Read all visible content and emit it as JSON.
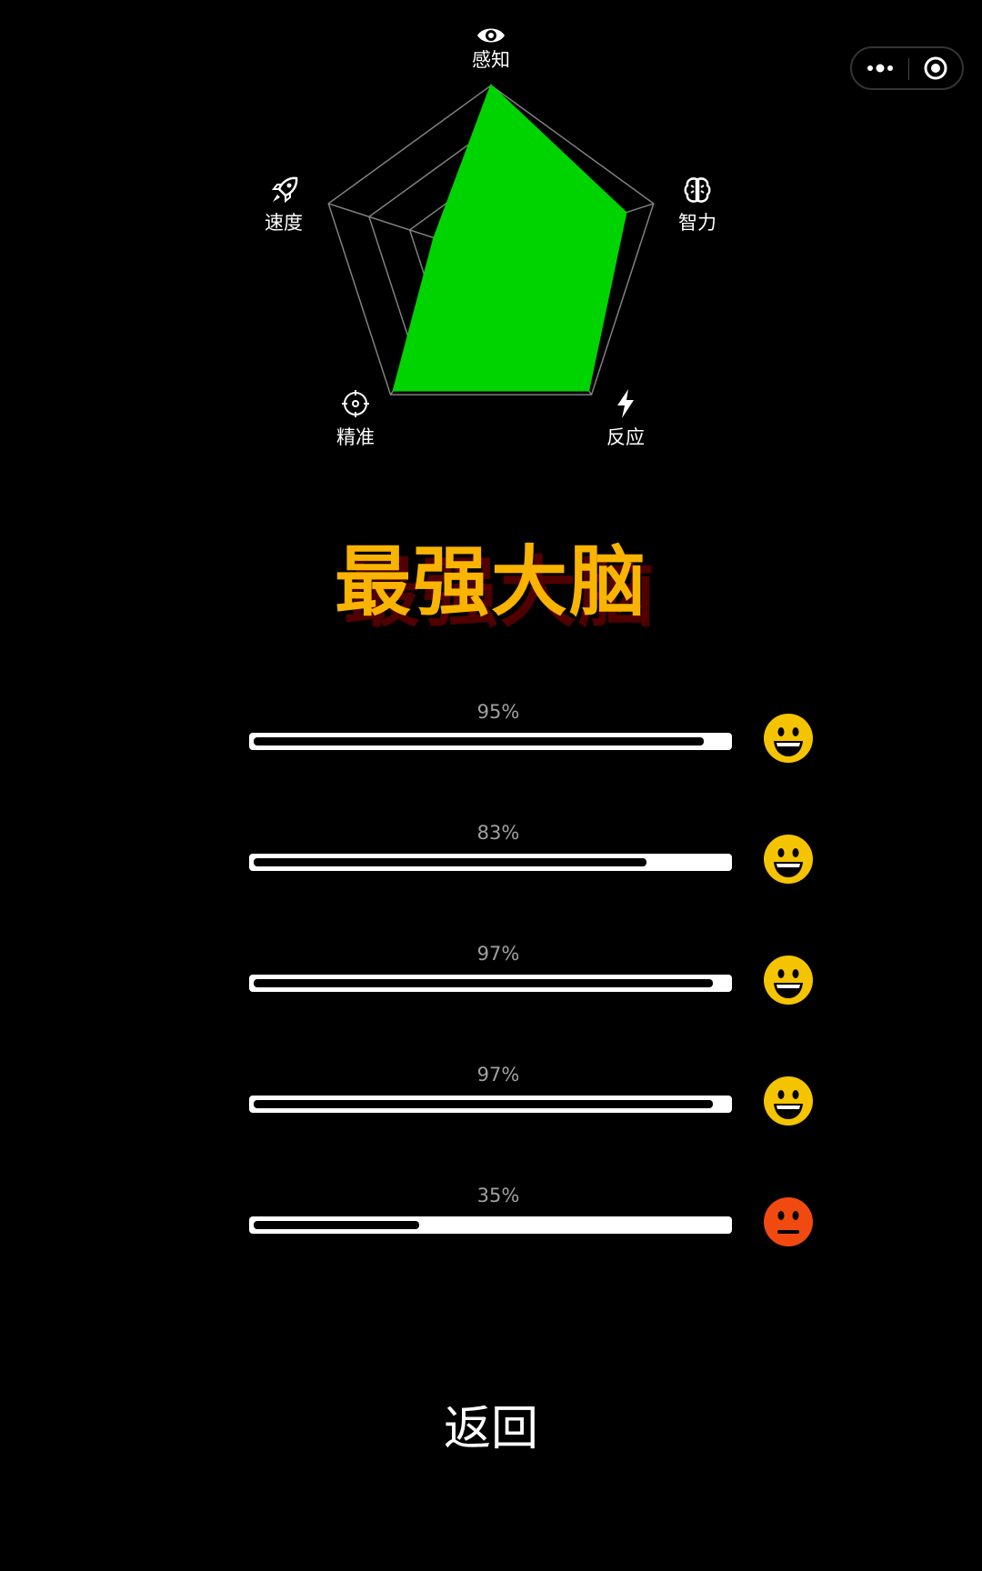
{
  "capsule": {
    "more_icon": "more-dots-icon",
    "close_icon": "target-circle-icon"
  },
  "radar": {
    "axes": [
      {
        "label": "感知",
        "icon": "eye-icon",
        "value": 1.0
      },
      {
        "label": "智力",
        "icon": "brain-icon",
        "value": 0.83
      },
      {
        "label": "反应",
        "icon": "lightning-icon",
        "value": 0.97
      },
      {
        "label": "精准",
        "icon": "crosshair-icon",
        "value": 0.97
      },
      {
        "label": "速度",
        "icon": "rocket-icon",
        "value": 0.35
      }
    ],
    "levels": 4,
    "fill_color": "#00d400",
    "grid_color": "#808080"
  },
  "title": "最强大脑",
  "colors": {
    "title": "#f8b400",
    "happy_face": "#f5c400",
    "neutral_face": "#f04a10"
  },
  "scores": [
    {
      "label": "95%",
      "value": 0.95,
      "mood": "happy"
    },
    {
      "label": "83%",
      "value": 0.83,
      "mood": "happy"
    },
    {
      "label": "97%",
      "value": 0.97,
      "mood": "happy"
    },
    {
      "label": "97%",
      "value": 0.97,
      "mood": "happy"
    },
    {
      "label": "35%",
      "value": 0.35,
      "mood": "neutral"
    }
  ],
  "back_label": "返回"
}
